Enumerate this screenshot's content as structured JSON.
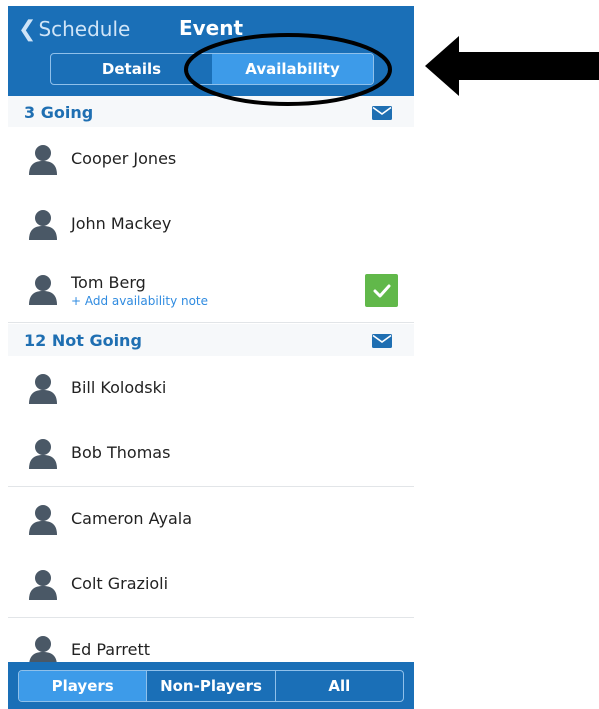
{
  "header": {
    "back_label": "Schedule",
    "title": "Event",
    "tabs": [
      {
        "label": "Details",
        "active": false
      },
      {
        "label": "Availability",
        "active": true
      }
    ]
  },
  "going": {
    "title": "3 Going",
    "members": [
      {
        "name": "Cooper Jones"
      },
      {
        "name": "John Mackey"
      },
      {
        "name": "Tom Berg",
        "note": "+ Add availability note",
        "checked": true
      }
    ]
  },
  "not_going": {
    "title": "12 Not Going",
    "members": [
      {
        "name": "Bill Kolodski"
      },
      {
        "name": "Bob Thomas"
      },
      {
        "name": "Cameron Ayala"
      },
      {
        "name": "Colt Grazioli"
      },
      {
        "name": "Ed Parrett"
      }
    ]
  },
  "footer": {
    "tabs": [
      {
        "label": "Players",
        "active": true
      },
      {
        "label": "Non-Players",
        "active": false
      },
      {
        "label": "All",
        "active": false
      }
    ]
  },
  "colors": {
    "nav_blue": "#1a6fb7",
    "active_tab": "#3d9be9",
    "section_text": "#1f6fb2",
    "check_green": "#61b84a"
  }
}
